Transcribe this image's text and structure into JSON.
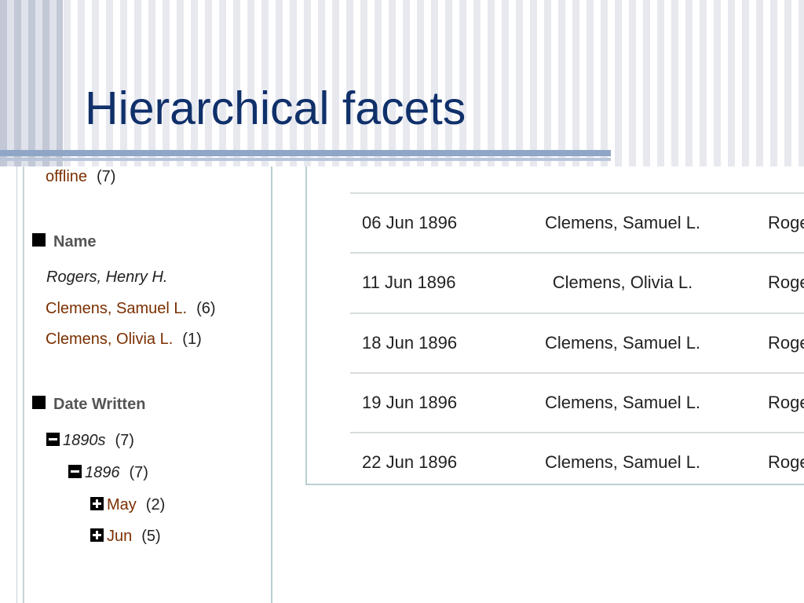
{
  "slide": {
    "title": "Hierarchical facets"
  },
  "facets": {
    "top_item": {
      "label": "offline",
      "count": "(7)"
    },
    "name": {
      "heading": "Name",
      "items": [
        {
          "label": "Rogers, Henry H.",
          "count": ""
        },
        {
          "label": "Clemens, Samuel L.",
          "count": "(6)"
        },
        {
          "label": "Clemens, Olivia L.",
          "count": "(1)"
        }
      ]
    },
    "date_written": {
      "heading": "Date Written",
      "decade": {
        "label": "1890s",
        "count": "(7)"
      },
      "year": {
        "label": "1896",
        "count": "(7)"
      },
      "months": [
        {
          "label": "May",
          "count": "(2)"
        },
        {
          "label": "Jun",
          "count": "(5)"
        }
      ]
    }
  },
  "results": {
    "rows": [
      {
        "date": "06 Jun 1896",
        "author": "Clemens, Samuel L.",
        "recipient": "Roge"
      },
      {
        "date": "11 Jun 1896",
        "author": "Clemens, Olivia L.",
        "recipient": "Roge"
      },
      {
        "date": "18 Jun 1896",
        "author": "Clemens, Samuel L.",
        "recipient": "Roge"
      },
      {
        "date": "19 Jun 1896",
        "author": "Clemens, Samuel L.",
        "recipient": "Roge"
      },
      {
        "date": "22 Jun 1896",
        "author": "Clemens, Samuel L.",
        "recipient": "Roge"
      }
    ]
  },
  "colors": {
    "title": "#10306a",
    "facet_link": "#7a2f00",
    "accent_bar": "#8fa6c6"
  }
}
